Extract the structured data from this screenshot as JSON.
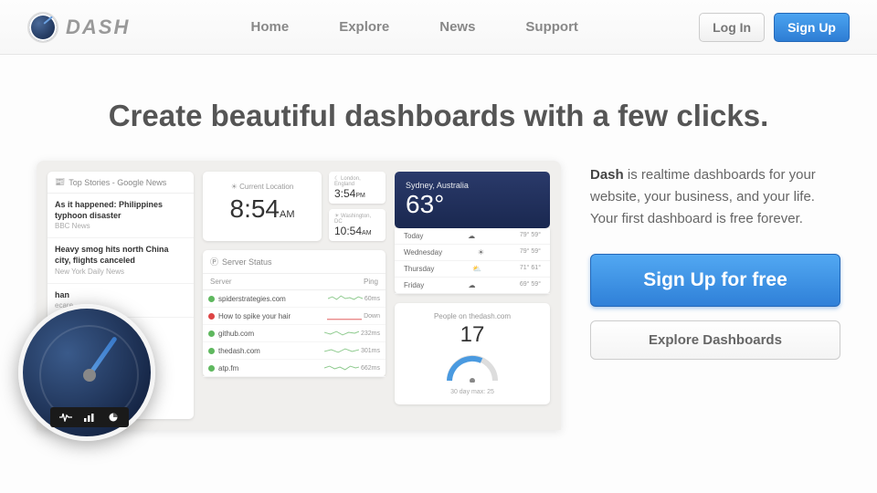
{
  "brand": "DASH",
  "nav": {
    "home": "Home",
    "explore": "Explore",
    "news": "News",
    "support": "Support"
  },
  "auth": {
    "login": "Log In",
    "signup": "Sign Up"
  },
  "hero": {
    "title": "Create beautiful dashboards with a few clicks."
  },
  "preview": {
    "news": {
      "header": "Top Stories - Google News",
      "items": [
        {
          "title": "As it happened: Philippines typhoon disaster",
          "source": "BBC News"
        },
        {
          "title": "Heavy smog hits north China city, flights canceled",
          "source": "New York Daily News"
        },
        {
          "title": "han",
          "source": "ecare"
        }
      ]
    },
    "clock": {
      "current_label": "Current Location",
      "current_time": "8:54",
      "current_ampm": "AM",
      "minis": [
        {
          "loc": "London, England",
          "time": "3:54",
          "ampm": "PM"
        },
        {
          "loc": "Washington, DC",
          "time": "10:54",
          "ampm": "AM"
        }
      ]
    },
    "servers": {
      "header": "Server Status",
      "col_server": "Server",
      "col_ping": "Ping",
      "rows": [
        {
          "status": "g",
          "name": "spiderstrategies.com",
          "ping": "60ms"
        },
        {
          "status": "r",
          "name": "How to spike your hair",
          "ping": "Down"
        },
        {
          "status": "g",
          "name": "github.com",
          "ping": "232ms"
        },
        {
          "status": "g",
          "name": "thedash.com",
          "ping": "301ms"
        },
        {
          "status": "g",
          "name": "atp.fm",
          "ping": "662ms"
        }
      ]
    },
    "weather": {
      "city": "Sydney, Australia",
      "temp": "63°",
      "forecast": [
        {
          "day": "Today",
          "hi": "79°",
          "lo": "59°"
        },
        {
          "day": "Wednesday",
          "hi": "79°",
          "lo": "59°"
        },
        {
          "day": "Thursday",
          "hi": "71°",
          "lo": "61°"
        },
        {
          "day": "Friday",
          "hi": "69°",
          "lo": "59°"
        }
      ]
    },
    "people": {
      "label": "People on thedash.com",
      "count": "17",
      "max": "30 day max: 25"
    }
  },
  "side": {
    "pitch_bold": "Dash",
    "pitch_rest": " is realtime dashboards for your website, your business, and your life. Your first dashboard is free forever.",
    "cta_primary": "Sign Up for free",
    "cta_secondary": "Explore Dashboards"
  }
}
